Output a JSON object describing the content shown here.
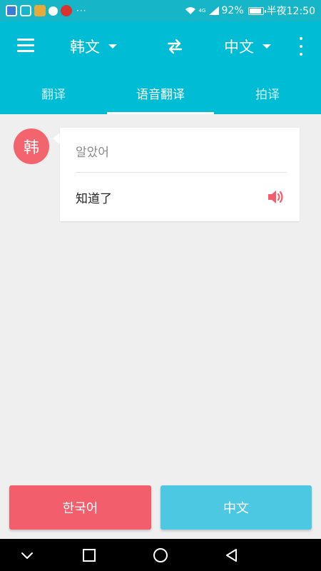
{
  "status_bar": {
    "battery": "92%",
    "time": "半夜12:50",
    "network": "4G",
    "dots": "···"
  },
  "app_bar": {
    "source_language": "韩文",
    "target_language": "中文"
  },
  "tabs": [
    {
      "label": "翻译",
      "active": false
    },
    {
      "label": "语音翻译",
      "active": true
    },
    {
      "label": "拍译",
      "active": false
    }
  ],
  "message": {
    "avatar_label": "韩",
    "source_text": "알았어",
    "translated_text": "知道了"
  },
  "buttons": {
    "korean_label": "한국어",
    "chinese_label": "中文"
  },
  "colors": {
    "primary": "#00bcd4",
    "korean_accent": "#f25e6c",
    "chinese_accent": "#4cc8e2"
  }
}
